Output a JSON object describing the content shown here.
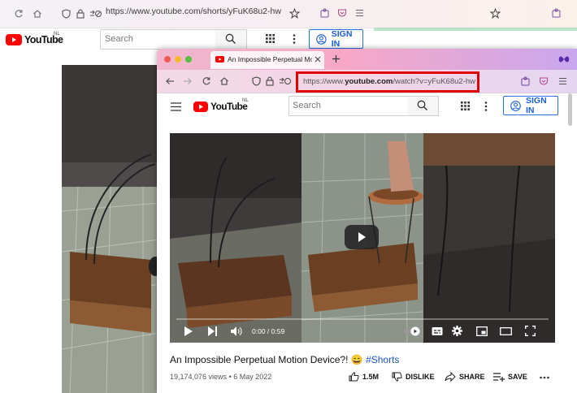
{
  "back_window": {
    "url": "https://www.youtube.com/shorts/yFuK68u2-hw",
    "logo_text": "YouTube",
    "logo_region": "NL",
    "search_placeholder": "Search",
    "sign_in_label": "SIGN IN"
  },
  "front_window": {
    "tab_title": "An Impossible Perpetual Motion",
    "url_prefix": "https://www.",
    "url_domain": "youtube.com",
    "url_path": "/watch?v=yFuK68u2-hw",
    "logo_text": "YouTube",
    "logo_region": "NL",
    "search_placeholder": "Search",
    "sign_in_label": "SIGN IN",
    "player": {
      "time_label": "0:00 / 0:59"
    },
    "video": {
      "title": "An Impossible Perpetual Motion Device?! 😄",
      "hashtag": "#Shorts",
      "views": "19,174,076 views",
      "date": "6 May 2022",
      "separator": "•",
      "likes": "1.5M",
      "dislike_label": "DISLIKE",
      "share_label": "SHARE",
      "save_label": "SAVE"
    }
  },
  "colors": {
    "highlight": "#e00000",
    "youtube_red": "#ff0000",
    "signin_blue": "#1d5fd6"
  }
}
